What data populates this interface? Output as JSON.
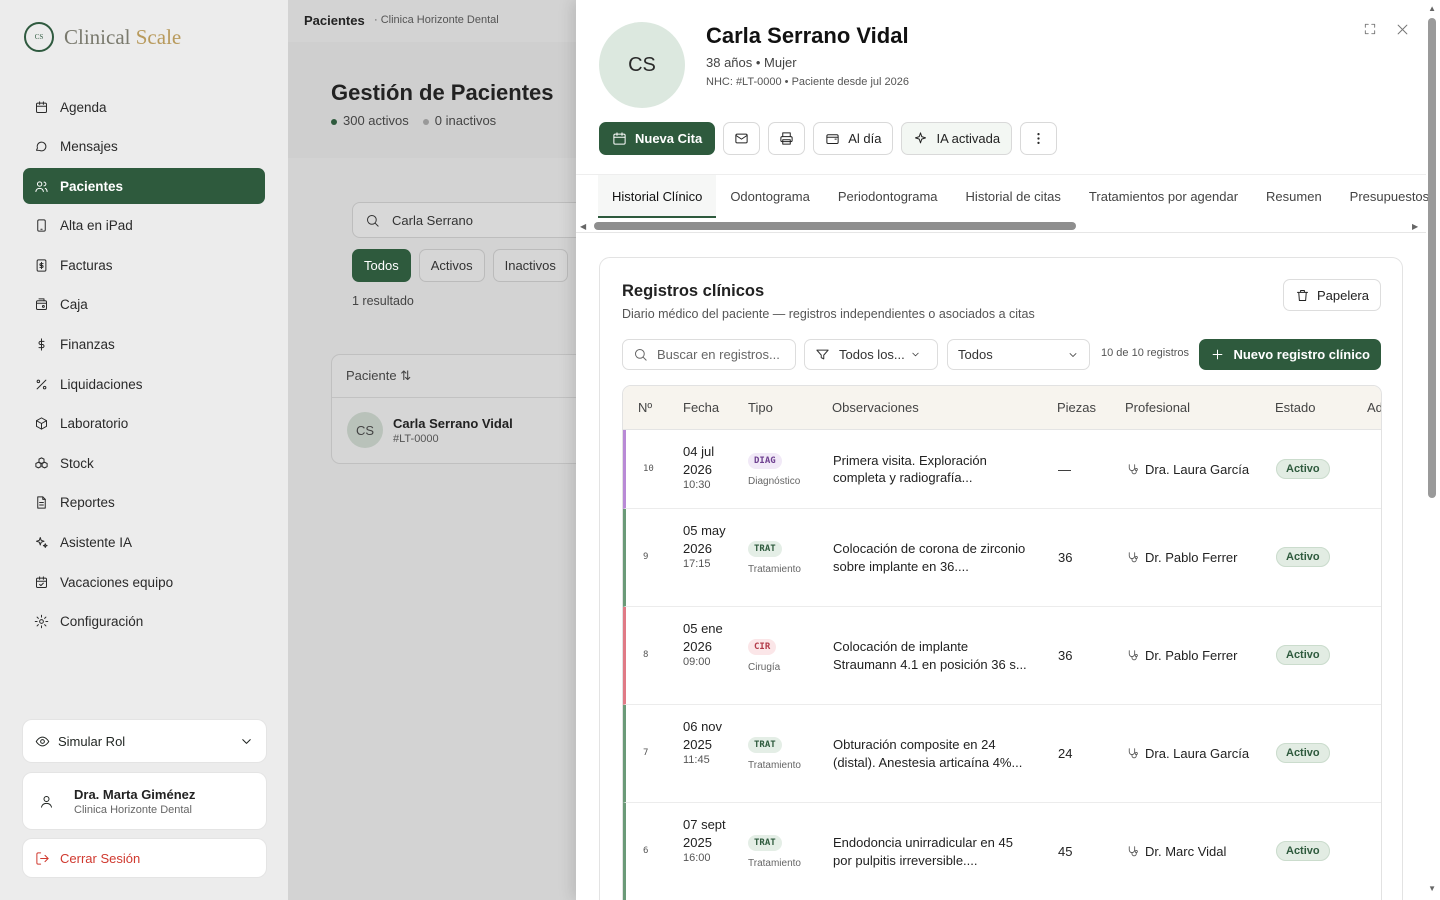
{
  "brand": {
    "logo_mark": "CS",
    "name_a": "Clinical",
    "name_b": "Scale"
  },
  "sidebar": {
    "items": [
      {
        "label": "Agenda",
        "icon": "calendar-icon"
      },
      {
        "label": "Mensajes",
        "icon": "message-icon"
      },
      {
        "label": "Pacientes",
        "icon": "users-icon",
        "active": true
      },
      {
        "label": "Alta en iPad",
        "icon": "tablet-icon"
      },
      {
        "label": "Facturas",
        "icon": "invoice-icon"
      },
      {
        "label": "Caja",
        "icon": "cash-register-icon"
      },
      {
        "label": "Finanzas",
        "icon": "dollar-icon"
      },
      {
        "label": "Liquidaciones",
        "icon": "percent-icon"
      },
      {
        "label": "Laboratorio",
        "icon": "package-icon"
      },
      {
        "label": "Stock",
        "icon": "boxes-icon"
      },
      {
        "label": "Reportes",
        "icon": "report-icon"
      },
      {
        "label": "Asistente IA",
        "icon": "sparkles-icon"
      },
      {
        "label": "Vacaciones equipo",
        "icon": "calendar-check-icon"
      },
      {
        "label": "Configuración",
        "icon": "gear-icon"
      }
    ],
    "role_label": "Simular Rol",
    "user": {
      "name": "Dra. Marta Giménez",
      "clinic": "Clinica Horizonte Dental"
    },
    "logout_label": "Cerrar Sesión"
  },
  "main": {
    "breadcrumb": "Pacientes",
    "breadcrumb_clinic": "· Clinica Horizonte Dental",
    "title": "Gestión de Pacientes",
    "active_count": "300 activos",
    "inactive_count": "0 inactivos",
    "search_value": "Carla Serrano",
    "filters": [
      "Todos",
      "Activos",
      "Inactivos"
    ],
    "results": "1 resultado",
    "column_patient": "Paciente ⇅",
    "row": {
      "initials": "CS",
      "name": "Carla Serrano Vidal",
      "id": "#LT-0000"
    }
  },
  "patient": {
    "initials": "CS",
    "name": "Carla Serrano Vidal",
    "meta": "38 años • Mujer",
    "nhc": "NHC: #LT-0000 • Paciente desde jul 2026"
  },
  "actions": {
    "new_appointment": "Nueva Cita",
    "status": "Al día",
    "ai": "IA activada"
  },
  "tabs": [
    "Historial Clínico",
    "Odontograma",
    "Periodontograma",
    "Historial de citas",
    "Tratamientos por agendar",
    "Resumen",
    "Presupuestos"
  ],
  "records": {
    "title": "Registros clínicos",
    "subtitle": "Diario médico del paciente — registros independientes o asociados a citas",
    "trash_label": "Papelera",
    "search_placeholder": "Buscar en registros...",
    "type_filter": "Todos los...",
    "status_filter": "Todos",
    "count": "10 de 10 registros",
    "new_label": "Nuevo registro clínico",
    "columns": [
      "Nº",
      "Fecha",
      "Tipo",
      "Observaciones",
      "Piezas",
      "Profesional",
      "Estado",
      "Adj."
    ],
    "rows": [
      {
        "n": "10",
        "date": "04 jul 2026",
        "time": "10:30",
        "badge": "DIAG",
        "type": "Diagnóstico",
        "obs": "Primera visita. Exploración completa y radiografía...",
        "pieces": "—",
        "prof": "Dra. Laura García",
        "status": "Activo",
        "color": "#b98ad6",
        "badge_bg": "#f1e9f7",
        "badge_fg": "#6d3f8f"
      },
      {
        "n": "9",
        "date": "05 may 2026",
        "time": "17:15",
        "badge": "TRAT",
        "type": "Tratamiento",
        "obs": "Colocación de corona de zirconio sobre implante en 36....",
        "pieces": "36",
        "prof": "Dr. Pablo Ferrer",
        "status": "Activo",
        "color": "#6b9a78",
        "badge_bg": "#e4eee6",
        "badge_fg": "#2e5a3d"
      },
      {
        "n": "8",
        "date": "05 ene 2026",
        "time": "09:00",
        "badge": "CIR",
        "type": "Cirugía",
        "obs": "Colocación de implante Straumann 4.1 en posición 36 s...",
        "pieces": "36",
        "prof": "Dr. Pablo Ferrer",
        "status": "Activo",
        "color": "#e07a86",
        "badge_bg": "#fbe6e8",
        "badge_fg": "#b23a48"
      },
      {
        "n": "7",
        "date": "06 nov 2025",
        "time": "11:45",
        "badge": "TRAT",
        "type": "Tratamiento",
        "obs": "Obturación composite en 24 (distal). Anestesia articaína 4%...",
        "pieces": "24",
        "prof": "Dra. Laura García",
        "status": "Activo",
        "color": "#6b9a78",
        "badge_bg": "#e4eee6",
        "badge_fg": "#2e5a3d"
      },
      {
        "n": "6",
        "date": "07 sept 2025",
        "time": "16:00",
        "badge": "TRAT",
        "type": "Tratamiento",
        "obs": "Endodoncia unirradicular en 45 por pulpitis irreversible....",
        "pieces": "45",
        "prof": "Dr. Marc Vidal",
        "status": "Activo",
        "color": "#6b9a78",
        "badge_bg": "#e4eee6",
        "badge_fg": "#2e5a3d"
      }
    ]
  }
}
